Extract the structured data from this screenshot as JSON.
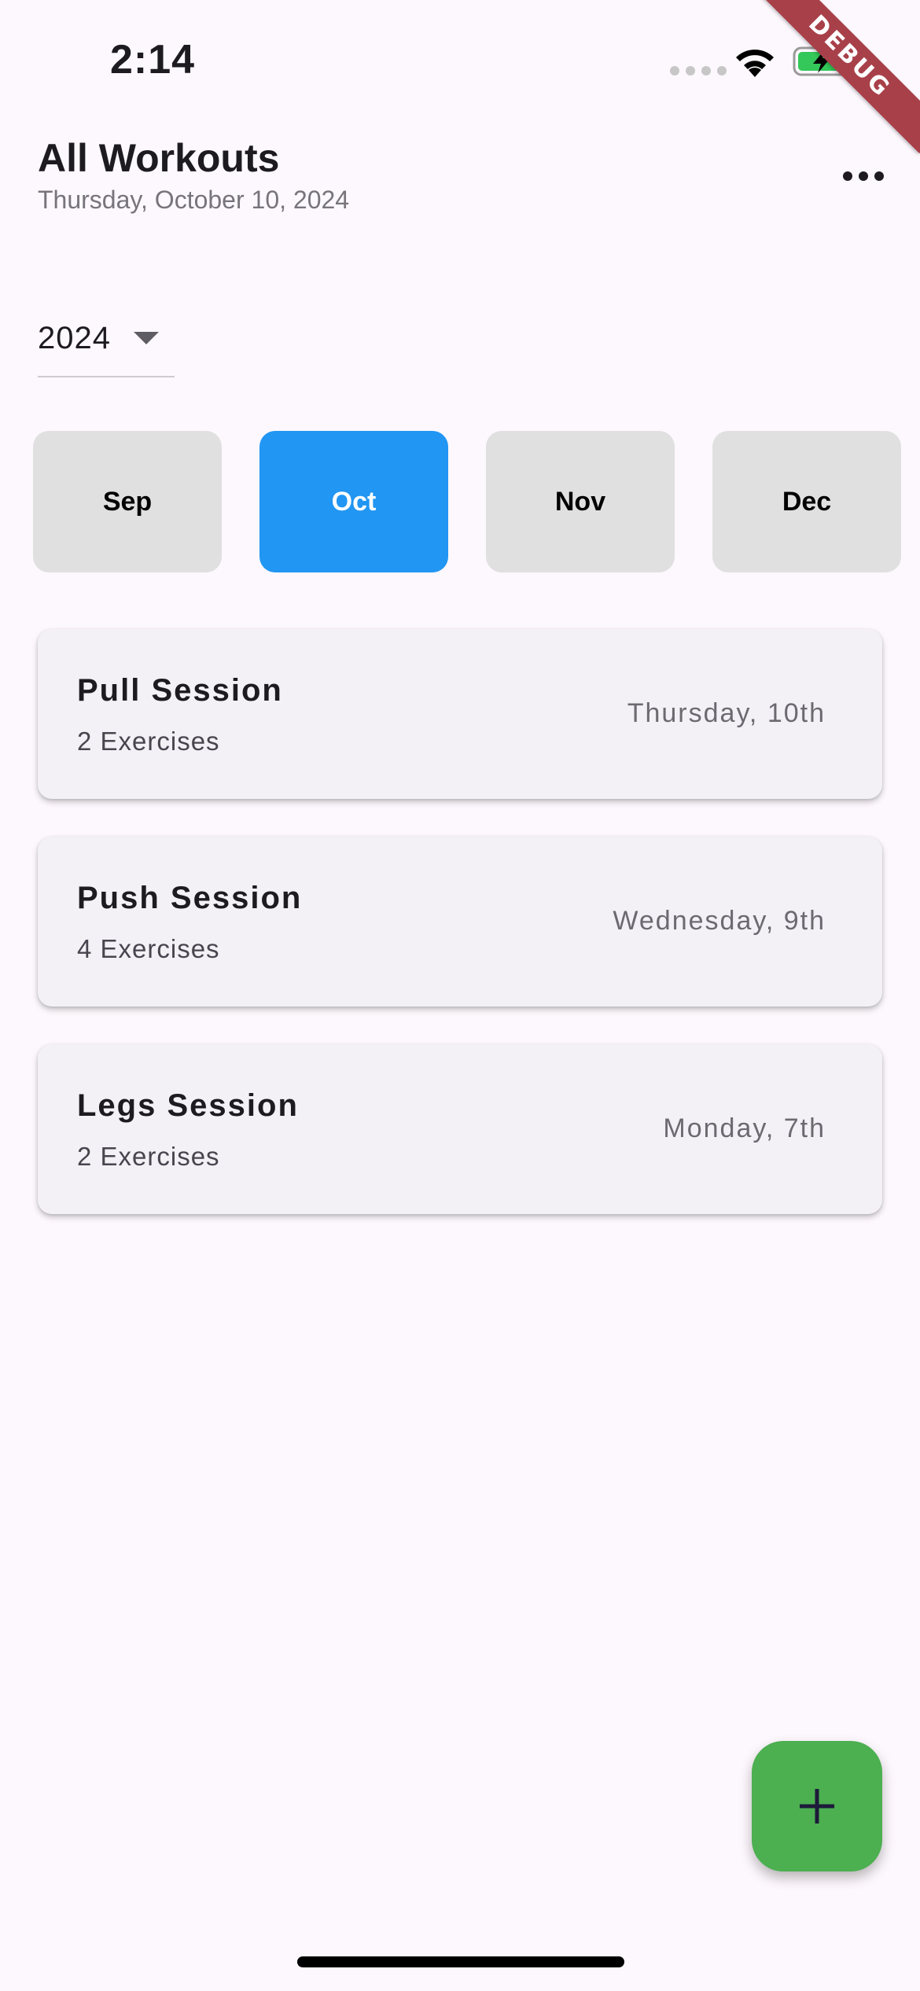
{
  "status_bar": {
    "time": "2:14",
    "icons": [
      "cellular-dots-icon",
      "wifi-icon",
      "battery-charging-icon"
    ]
  },
  "debug_banner": "DEBUG",
  "header": {
    "title": "All Workouts",
    "subtitle": "Thursday, October 10, 2024",
    "menu_icon": "more-horizontal-icon"
  },
  "year_selector": {
    "value": "2024"
  },
  "months": [
    {
      "label": "Sep",
      "selected": false
    },
    {
      "label": "Oct",
      "selected": true
    },
    {
      "label": "Nov",
      "selected": false
    },
    {
      "label": "Dec",
      "selected": false
    }
  ],
  "workouts": [
    {
      "name": "Pull Session",
      "exercises": "2 Exercises",
      "date": "Thursday, 10th"
    },
    {
      "name": "Push Session",
      "exercises": "4 Exercises",
      "date": "Wednesday, 9th"
    },
    {
      "name": "Legs Session",
      "exercises": "2 Exercises",
      "date": "Monday, 7th"
    }
  ],
  "fab": {
    "icon": "plus-icon"
  },
  "colors": {
    "background": "#fdf8fd",
    "selected_month": "#2196f3",
    "unselected_month": "#e0e0e0",
    "card": "#f4f1f6",
    "fab": "#4caf50",
    "debug_ribbon": "#a8404a"
  }
}
